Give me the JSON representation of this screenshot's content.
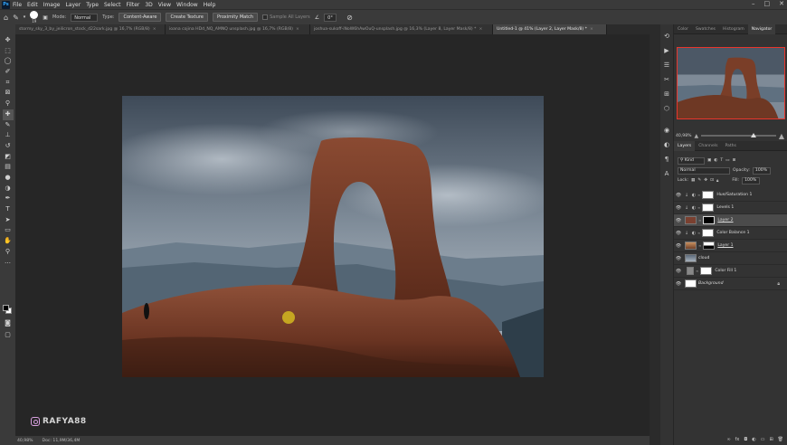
{
  "app": {
    "logo": "Ps",
    "menu": [
      "File",
      "Edit",
      "Image",
      "Layer",
      "Type",
      "Select",
      "Filter",
      "3D",
      "View",
      "Window",
      "Help"
    ],
    "window_controls": [
      "–",
      "□",
      "✕"
    ]
  },
  "options_bar": {
    "brush_size": "19",
    "mode_label": "Mode:",
    "mode_value": "Normal",
    "type_label": "Type:",
    "type_content_aware": "Content-Aware",
    "type_create_texture": "Create Texture",
    "type_proximity_match": "Proximity Match",
    "sample_all_layers": "Sample All Layers",
    "angle_value": "0°"
  },
  "tabs": [
    {
      "label": "stormy_sky_3_by_jeilicron_stock_d22sark.jpg @ 16,7% (RGB/8)",
      "active": false
    },
    {
      "label": "ioana cojina HDd_NQ_AMNQ unsplash.jpg @ 16,7% (RGB/8)",
      "active": false
    },
    {
      "label": "joshua-sukoff-iNoW6hAwOuQ-unsplash.jpg @ 16,3% (Layer 8, Layer Mask/8) *",
      "active": false
    },
    {
      "label": "Untitled-1 @ 41% (Layer 2, Layer Mask/8) *",
      "active": true
    }
  ],
  "status": {
    "zoom": "40,98%",
    "doc": "Doc: 11,9M/36,4M"
  },
  "watermark": "RAFYA88",
  "right_panel": {
    "top_tabs": [
      "Color",
      "Swatches",
      "Histogram",
      "Navigator"
    ],
    "active_top_tab": "Navigator",
    "navigator_zoom": "40,98%",
    "layer_tabs": [
      "Layers",
      "Channels",
      "Paths"
    ],
    "kind_label": "Kind",
    "blend_mode": "Normal",
    "opacity_label": "Opacity:",
    "opacity_value": "100%",
    "lock_label": "Lock:",
    "fill_label": "Fill:",
    "fill_value": "100%",
    "layers": [
      {
        "name": "Hue/Saturation 1",
        "thumb_color": "#ffffff",
        "mask": true,
        "adj": "◐",
        "selected": false,
        "indent": true
      },
      {
        "name": "Levels 1",
        "thumb_color": "#ffffff",
        "mask": true,
        "adj": "◐",
        "selected": false,
        "indent": true
      },
      {
        "name": "Layer 2",
        "thumb_color": "#7a4030",
        "mask": true,
        "adj": "",
        "selected": true,
        "indent": false
      },
      {
        "name": "Color Balance 1",
        "thumb_color": "#ffffff",
        "mask": true,
        "adj": "◐",
        "selected": false,
        "indent": true
      },
      {
        "name": "Layer 1",
        "thumb_color": "#c08050",
        "mask": true,
        "adj": "",
        "selected": false,
        "indent": false
      },
      {
        "name": "cloud",
        "thumb_color": "#8a98a8",
        "mask": false,
        "adj": "",
        "selected": false,
        "indent": false
      },
      {
        "name": "Color Fill 1",
        "thumb_color": "#888888",
        "mask": true,
        "adj": "",
        "selected": false,
        "indent": false
      },
      {
        "name": "Background",
        "thumb_color": "#ffffff",
        "mask": false,
        "adj": "",
        "selected": false,
        "indent": false,
        "locked": true
      }
    ]
  }
}
